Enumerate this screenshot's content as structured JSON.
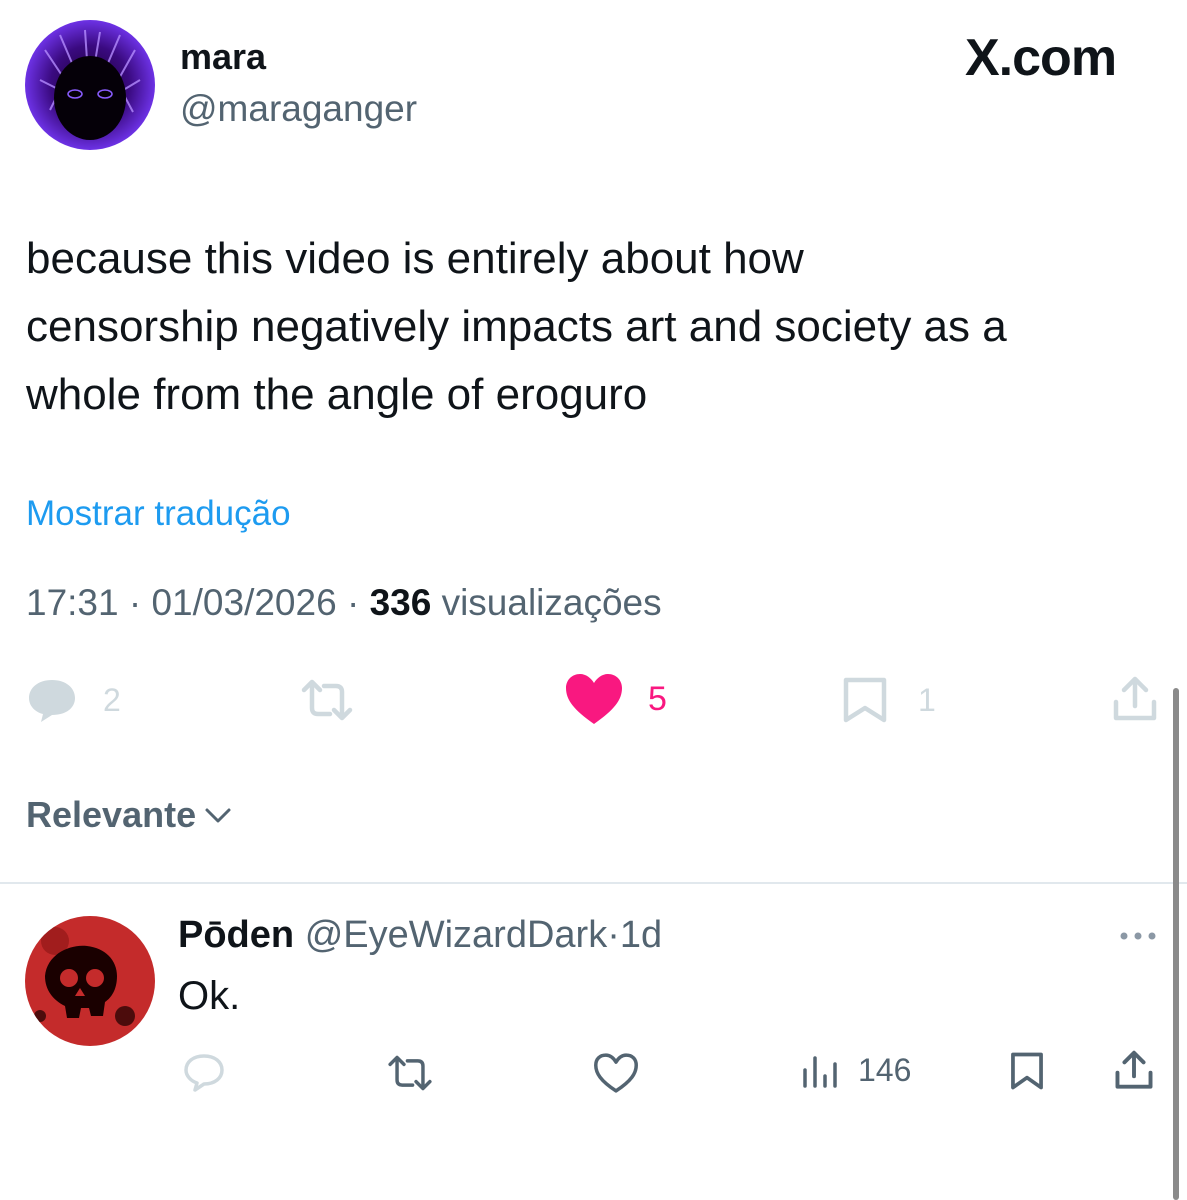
{
  "brand": {
    "watermark": "X.com"
  },
  "tweet": {
    "author_name": "mara",
    "author_handle": "@maraganger",
    "text_lines": [
      "because this video is entirely about how",
      "censorship negatively impacts art and society as a",
      "whole from the angle of eroguro"
    ],
    "translate_label": "Mostrar tradução",
    "time": "17:31",
    "separator": "·",
    "date": "01/03/2026",
    "views_count": "336",
    "views_label": "visualizações",
    "actions": {
      "reply_count": "2",
      "like_count": "5",
      "bookmark_count": "1"
    }
  },
  "sort": {
    "label": "Relevante"
  },
  "reply": {
    "author_name": "Pōden",
    "author_handle": "@EyeWizardDark",
    "separator": "·",
    "age": "1d",
    "text": "Ok.",
    "views_count": "146"
  },
  "colors": {
    "text": "#0f1419",
    "secondary": "#536471",
    "icon_gray": "#cfd9de",
    "link": "#1d9bf0",
    "like": "#f91880",
    "divider": "#e1e8ed"
  },
  "icons": {
    "reply": "reply-icon",
    "retweet": "retweet-icon",
    "like": "heart-icon",
    "bookmark": "bookmark-icon",
    "share": "share-icon",
    "views": "views-icon",
    "more": "more-icon",
    "chevron": "chevron-down-icon"
  }
}
